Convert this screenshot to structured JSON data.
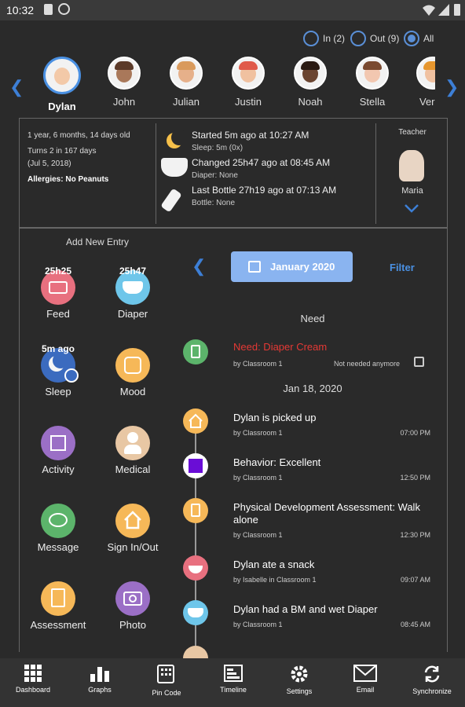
{
  "status_bar": {
    "time": "10:32"
  },
  "filter": {
    "in_label": "In (2)",
    "out_label": "Out (9)",
    "all_label": "All",
    "selected": "All"
  },
  "children": [
    {
      "name": "Dylan",
      "selected": true
    },
    {
      "name": "John"
    },
    {
      "name": "Julian"
    },
    {
      "name": "Justin"
    },
    {
      "name": "Noah"
    },
    {
      "name": "Stella"
    },
    {
      "name": "Ver"
    }
  ],
  "child_info": {
    "age": "1 year, 6 months, 14 days old",
    "turns": "Turns 2 in 167 days",
    "birthday": "(Jul 5, 2018)",
    "allergies": "Allergies: No Peanuts"
  },
  "status": {
    "sleep_main": "Started  5m ago  at 10:27 AM",
    "sleep_sub": "Sleep:  5m (0x)",
    "diaper_main": "Changed  25h47 ago  at 08:45 AM",
    "diaper_sub": "Diaper:  None",
    "bottle_main": "Last Bottle  27h19 ago  at 07:13 AM",
    "bottle_sub": "Bottle:  None"
  },
  "teacher": {
    "label": "Teacher",
    "name": "Maria"
  },
  "add_entry": {
    "title": "Add New Entry",
    "items": [
      {
        "label": "Feed",
        "badge": "25h25",
        "icon": "feed-icon",
        "color": "#e8707f"
      },
      {
        "label": "Diaper",
        "badge": "25h47",
        "icon": "diaper-icon",
        "color": "#6ec6ea"
      },
      {
        "label": "Sleep",
        "badge": "5m ago",
        "icon": "sleep-icon",
        "color": "#3b6bbf"
      },
      {
        "label": "Mood",
        "icon": "mood-icon",
        "color": "#f6b858"
      },
      {
        "label": "Activity",
        "icon": "activity-icon",
        "color": "#9b6fc6"
      },
      {
        "label": "Medical",
        "icon": "medical-icon",
        "color": "#e8c7a4"
      },
      {
        "label": "Message",
        "icon": "message-icon",
        "color": "#5cb46b"
      },
      {
        "label": "Sign In/Out",
        "icon": "house-icon",
        "color": "#f6b858"
      },
      {
        "label": "Assessment",
        "icon": "clipboard-icon",
        "color": "#f6b858"
      },
      {
        "label": "Photo",
        "icon": "camera-icon",
        "color": "#9b6fc6"
      }
    ]
  },
  "timeline": {
    "month": "January 2020",
    "filter_label": "Filter",
    "need_header": "Need",
    "need": {
      "title": "Need: Diaper Cream",
      "by": "by Classroom 1",
      "not_needed": "Not needed anymore"
    },
    "date_header": "Jan 18, 2020",
    "items": [
      {
        "title": "Dylan is picked up",
        "by": "by Classroom 1",
        "time": "07:00 PM",
        "icon": "house-icon",
        "color": "#f6b858"
      },
      {
        "title": "Behavior: Excellent",
        "by": "by Classroom 1",
        "time": "12:50 PM",
        "icon": "behavior-icon",
        "color": "#ffffff"
      },
      {
        "title": "Physical Development Assessment: Walk alone",
        "by": "by Classroom 1",
        "time": "12:30 PM",
        "icon": "clipboard-icon",
        "color": "#f6b858"
      },
      {
        "title": "Dylan ate a snack",
        "by": "by Isabelle in Classroom 1",
        "time": "09:07 AM",
        "icon": "bowl-icon",
        "color": "#e8707f"
      },
      {
        "title": "Dylan had a BM and wet Diaper",
        "by": "by Classroom 1",
        "time": "08:45 AM",
        "icon": "diaper-icon",
        "color": "#6ec6ea"
      }
    ]
  },
  "nav": [
    {
      "label": "Dashboard",
      "icon": "grid-icon"
    },
    {
      "label": "Graphs",
      "icon": "bar-chart-icon"
    },
    {
      "label": "Pin Code",
      "icon": "keypad-icon"
    },
    {
      "label": "Timeline",
      "icon": "timeline-icon"
    },
    {
      "label": "Settings",
      "icon": "gear-icon"
    },
    {
      "label": "Email",
      "icon": "envelope-icon"
    },
    {
      "label": "Synchronize",
      "icon": "sync-icon"
    }
  ]
}
